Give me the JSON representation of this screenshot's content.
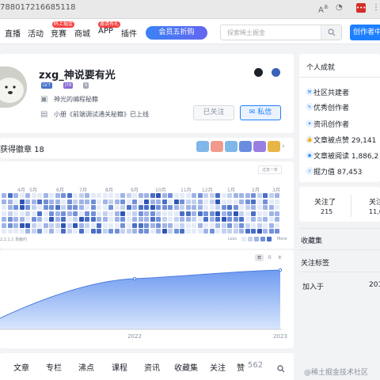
{
  "browser": {
    "url": "788017216685118",
    "icons": [
      "translate-icon",
      "extension-icon",
      "lastpass-icon",
      "menu-icon"
    ]
  },
  "topnav": {
    "items": [
      {
        "label": "直播"
      },
      {
        "label": "活动"
      },
      {
        "label": "竞赛",
        "badge": "码上掘金"
      },
      {
        "label": "商城"
      },
      {
        "label": "APP",
        "badge": "邀请有礼"
      },
      {
        "label": "插件"
      }
    ],
    "vip_label": "会员五折购",
    "search_placeholder": "探索稀土掘金",
    "creator_label": "创作者中心"
  },
  "profile": {
    "name": "zxg_神说要有光",
    "levels": [
      "LV.7",
      "JY.8",
      "9"
    ],
    "job": "神光的编程秘籍",
    "desc": "小册《前端调试通关秘籍》已上线",
    "follow_label": "已关注",
    "message_label": "私信"
  },
  "badges": {
    "title": "获得徽章 18"
  },
  "heatmap": {
    "selector": "过去一年",
    "months": [
      "4月",
      "5月",
      "6月",
      "7月",
      "8月",
      "9月",
      "10月",
      "11月",
      "12月",
      "1月",
      "2月",
      "3月"
    ],
    "footer_left": "2,2,1,1 贡献约",
    "footer_right": "Less",
    "footer_more": "More"
  },
  "trend": {
    "toggles": [
      "日",
      "月",
      "年"
    ],
    "x_labels": [
      "2022",
      "2023"
    ]
  },
  "chart_data": {
    "type": "area",
    "x": [
      "",
      "2022",
      "2023"
    ],
    "values": [
      0.18,
      0.82,
      0.96
    ],
    "xlabel": "",
    "ylabel": ""
  },
  "tabs": [
    {
      "label": "文章"
    },
    {
      "label": "专栏"
    },
    {
      "label": "沸点"
    },
    {
      "label": "课程"
    },
    {
      "label": "资讯"
    },
    {
      "label": "收藏集"
    },
    {
      "label": "关注"
    },
    {
      "label": "赞",
      "count": "562"
    }
  ],
  "achievements": {
    "title": "个人成就",
    "items": [
      {
        "icon": "community-icon",
        "label": "社区共建者"
      },
      {
        "icon": "creator-icon",
        "label": "优秀创作者"
      },
      {
        "icon": "news-icon",
        "label": "资讯创作者"
      },
      {
        "icon": "like-icon",
        "label": "文章被点赞 29,141"
      },
      {
        "icon": "eye-icon",
        "label": "文章被阅读 1,886,2"
      },
      {
        "icon": "power-icon",
        "label": "掘力值 87,453"
      }
    ]
  },
  "follow_stats": {
    "following_label": "关注了",
    "following_value": "215",
    "followers_label": "关注者",
    "followers_value": "11,6"
  },
  "side_links": {
    "collections": "收藏集",
    "tags": "关注标签",
    "joined_label": "加入于",
    "joined_value": "201"
  },
  "watermark": "@稀土掘金技术社区",
  "colors": {
    "accent": "#1e80ff",
    "heat_levels": [
      "#e5ebf7",
      "#c3d1ef",
      "#9fb3e6",
      "#7290d8",
      "#4a6fc6",
      "#2f55b5"
    ]
  }
}
